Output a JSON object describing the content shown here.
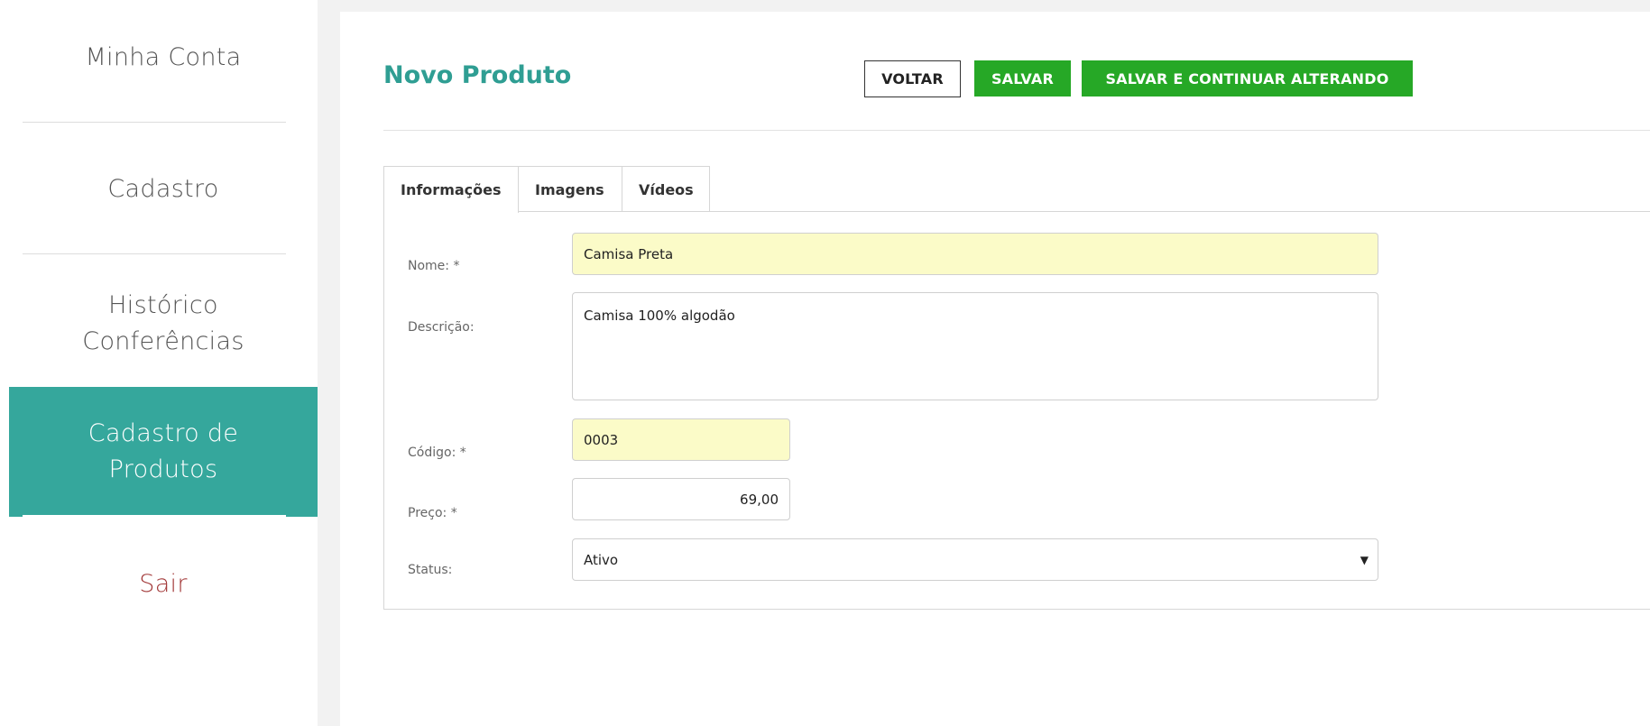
{
  "sidebar": {
    "items": [
      {
        "label": "Minha Conta"
      },
      {
        "label": "Cadastro"
      },
      {
        "label": "Histórico Conferências"
      },
      {
        "label": "Cadastro de Produtos"
      },
      {
        "label": "Sair"
      }
    ]
  },
  "header": {
    "title": "Novo Produto",
    "back_label": "VOLTAR",
    "save_label": "SALVAR",
    "save_continue_label": "SALVAR E CONTINUAR ALTERANDO"
  },
  "tabs": [
    {
      "label": "Informações",
      "active": true
    },
    {
      "label": "Imagens",
      "active": false
    },
    {
      "label": "Vídeos",
      "active": false
    }
  ],
  "form": {
    "nome": {
      "label": "Nome: *",
      "value": "Camisa Preta"
    },
    "descricao": {
      "label": "Descrição:",
      "value": "Camisa 100% algodão"
    },
    "codigo": {
      "label": "Código: *",
      "value": "0003"
    },
    "preco": {
      "label": "Preço: *",
      "value": "69,00"
    },
    "status": {
      "label": "Status:",
      "value": "Ativo"
    }
  },
  "colors": {
    "accent": "#35a79c",
    "title": "#2f9e93",
    "button_green": "#26a826",
    "required_field_bg": "#fbfbc8",
    "logout_text": "#a33a3a"
  },
  "icons": {
    "status_dropdown": "caret-down-icon"
  }
}
